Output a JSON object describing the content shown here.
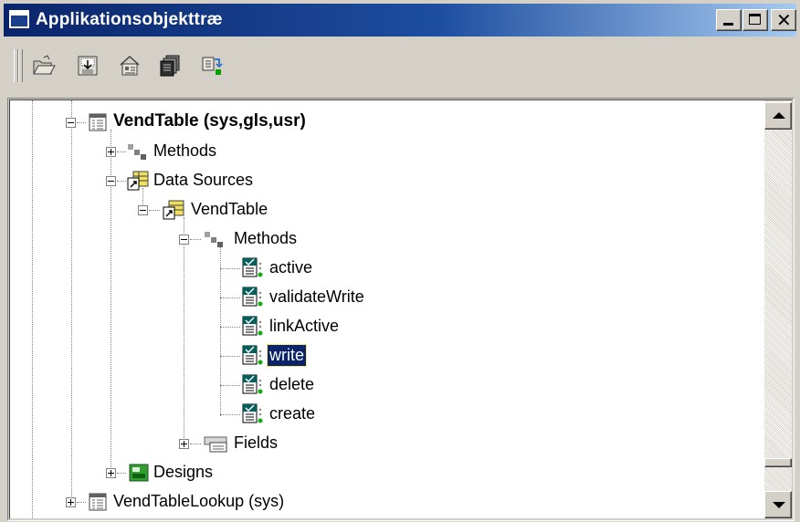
{
  "window": {
    "title": "Applikationsobjekttræ",
    "minimize_label": "minimize",
    "maximize_label": "maximize",
    "close_label": "close"
  },
  "toolbar": {
    "tools": [
      "open-icon",
      "save-icon",
      "properties-icon",
      "duplicate-icon",
      "compile-icon"
    ]
  },
  "tree": {
    "nodes": [
      {
        "label": "VendTable (sys,gls,usr)",
        "icon": "form-icon",
        "expander": "minus",
        "bold": true
      },
      {
        "label": "Methods",
        "icon": "methods-icon",
        "expander": "plus"
      },
      {
        "label": "Data Sources",
        "icon": "datasources-icon",
        "expander": "minus"
      },
      {
        "label": "VendTable",
        "icon": "datasource-icon",
        "expander": "minus"
      },
      {
        "label": "Methods",
        "icon": "methods-icon",
        "expander": "minus"
      },
      {
        "label": "active",
        "icon": "method-icon"
      },
      {
        "label": "validateWrite",
        "icon": "method-icon"
      },
      {
        "label": "linkActive",
        "icon": "method-icon"
      },
      {
        "label": "write",
        "icon": "method-icon",
        "selected": true
      },
      {
        "label": "delete",
        "icon": "method-icon"
      },
      {
        "label": "create",
        "icon": "method-icon"
      },
      {
        "label": "Fields",
        "icon": "fields-icon",
        "expander": "plus"
      },
      {
        "label": "Designs",
        "icon": "designs-icon",
        "expander": "plus"
      },
      {
        "label": "VendTableLookup (sys)",
        "icon": "form-icon",
        "expander": "plus"
      }
    ]
  },
  "colors": {
    "title_gradient_start": "#0a246a",
    "title_gradient_end": "#a6caf0",
    "selection": "#0a246a",
    "chrome": "#d4d0c8"
  }
}
